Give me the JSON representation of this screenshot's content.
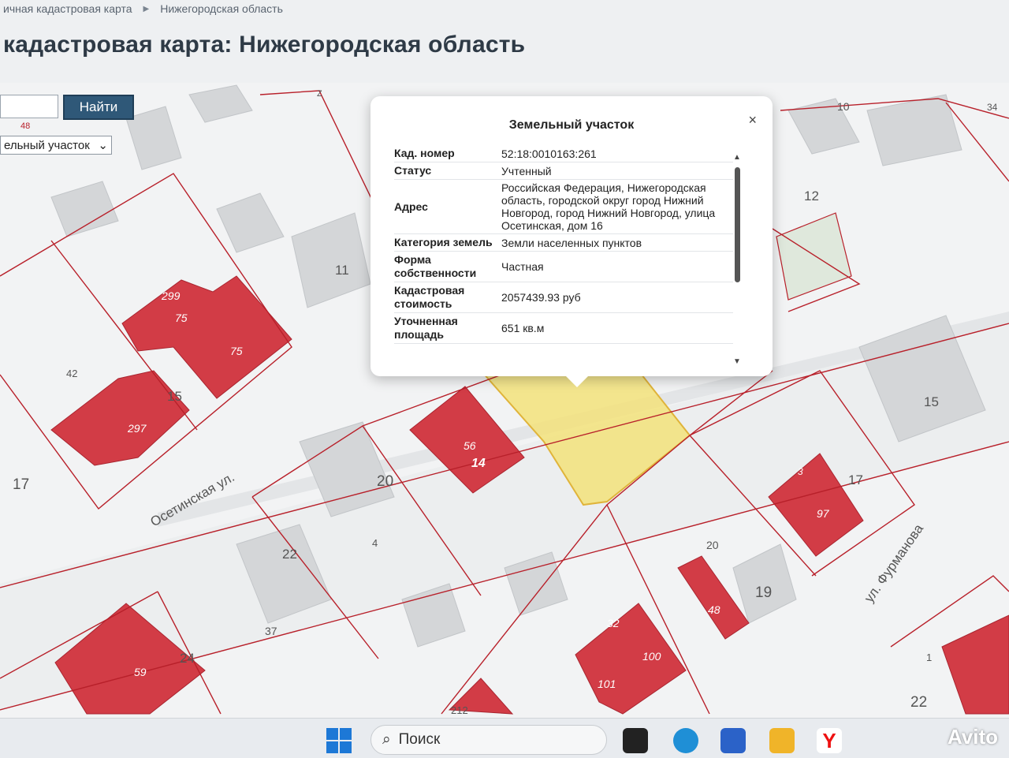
{
  "breadcrumb": {
    "item1": "ичная кадастровая карта",
    "item2": "Нижегородская область"
  },
  "page_title": "кадастровая карта: Нижегородская область",
  "search": {
    "button": "Найти",
    "input_value": ""
  },
  "type_select": {
    "value": "ельный участок"
  },
  "popup": {
    "title": "Земельный участок",
    "close": "×",
    "rows": [
      {
        "key": "Кад. номер",
        "value": "52:18:0010163:261"
      },
      {
        "key": "Статус",
        "value": "Учтенный"
      },
      {
        "key": "Адрес",
        "value": "Российская Федерация, Нижегородская область, городской округ город Нижний Новгород, город Нижний Новгород, улица Осетинская, дом 16"
      },
      {
        "key": "Категория земель",
        "value": "Земли населенных пунктов"
      },
      {
        "key": "Форма собственности",
        "value": "Частная"
      },
      {
        "key": "Кадастровая стоимость",
        "value": "2057439.93 руб"
      },
      {
        "key": "Уточненная площадь",
        "value": "651 кв.м"
      }
    ]
  },
  "map": {
    "streets": [
      {
        "name": "Осетинская ул."
      },
      {
        "name": "ул. Фурманова"
      }
    ],
    "numbers": [
      "11",
      "12",
      "15",
      "17",
      "20",
      "4",
      "22",
      "37",
      "24",
      "42",
      "17",
      "299",
      "75",
      "75",
      "297",
      "15",
      "56",
      "14",
      "3",
      "97",
      "17",
      "20",
      "48",
      "19",
      "32",
      "100",
      "101",
      "59",
      "212",
      "1",
      "22",
      "10",
      "34",
      "48",
      "Z"
    ],
    "colors": {
      "building_red": "#d23c46",
      "building_gray": "#d4d6d8",
      "parcel_line": "#b8202a",
      "highlight_fill": "#f3e27a",
      "highlight_stroke": "#e0b43a"
    }
  },
  "taskbar": {
    "search_label": "Поиск",
    "watermark": "Avito"
  }
}
